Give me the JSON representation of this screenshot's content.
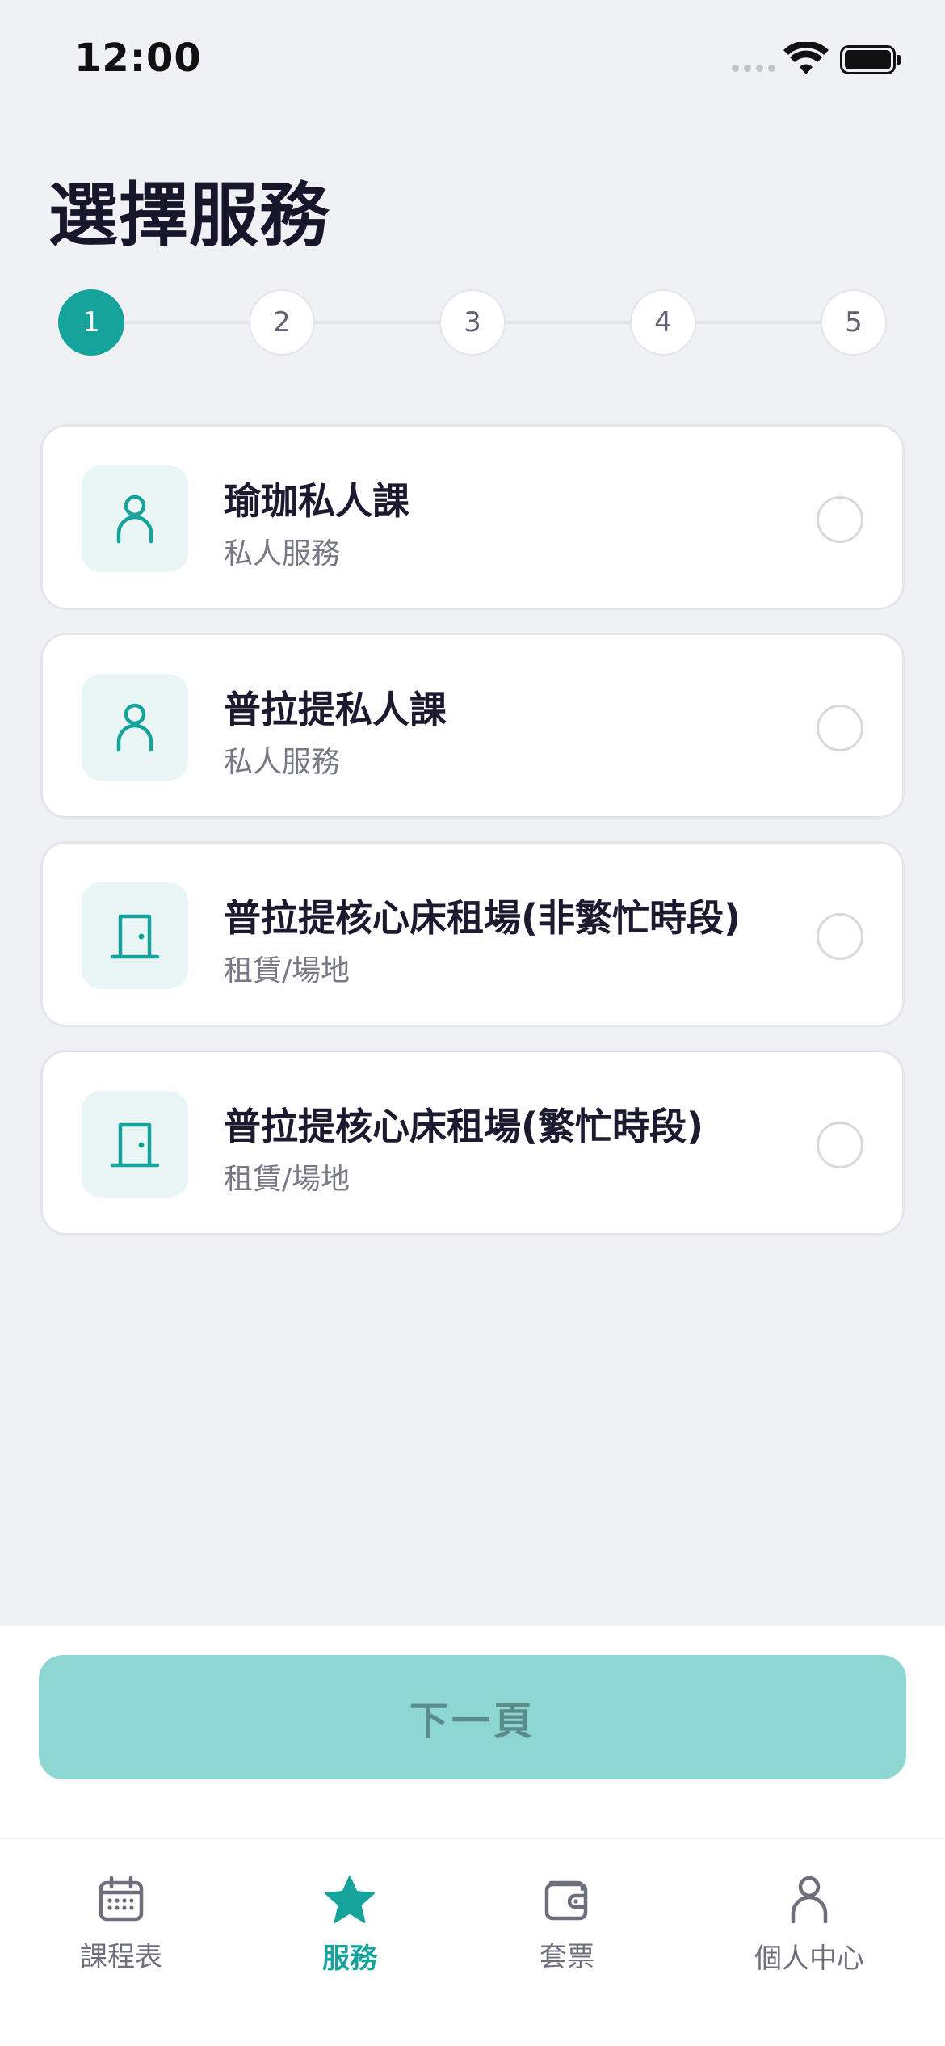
{
  "status_bar": {
    "time": "12:00"
  },
  "page": {
    "title": "選擇服務"
  },
  "stepper": {
    "steps": [
      "1",
      "2",
      "3",
      "4",
      "5"
    ],
    "current_step": 1
  },
  "services": [
    {
      "title": "瑜珈私人課",
      "subtitle": "私人服務",
      "icon": "person-icon",
      "selected": false
    },
    {
      "title": "普拉提私人課",
      "subtitle": "私人服務",
      "icon": "person-icon",
      "selected": false
    },
    {
      "title": "普拉提核心床租場(非繁忙時段)",
      "subtitle": "租賃/場地",
      "icon": "door-icon",
      "selected": false
    },
    {
      "title": "普拉提核心床租場(繁忙時段)",
      "subtitle": "租賃/場地",
      "icon": "door-icon",
      "selected": false
    }
  ],
  "actions": {
    "next_label": "下一頁",
    "next_enabled": false
  },
  "tab_bar": {
    "items": [
      {
        "label": "課程表",
        "icon": "calendar-icon"
      },
      {
        "label": "服務",
        "icon": "star-icon",
        "active": true
      },
      {
        "label": "套票",
        "icon": "wallet-icon"
      },
      {
        "label": "個人中心",
        "icon": "person-icon"
      }
    ]
  },
  "colors": {
    "accent": "#15a39c",
    "button_disabled": "#8ed6d2",
    "background": "#f0f1f5",
    "icon_tile": "#e9f6f5"
  }
}
